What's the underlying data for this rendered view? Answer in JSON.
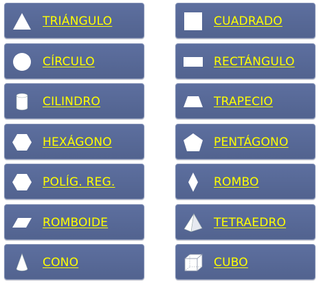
{
  "colors": {
    "tile_bg": "#58699a",
    "label": "#ffff00",
    "icon": "#ffffff"
  },
  "left_column": [
    {
      "label": "TRIÁNGULO",
      "icon": "triangle-icon"
    },
    {
      "label": "CÍRCULO",
      "icon": "circle-icon"
    },
    {
      "label": "CILINDRO",
      "icon": "cylinder-icon"
    },
    {
      "label": "HEXÁGONO",
      "icon": "hexagon-icon"
    },
    {
      "label": "POLÍG. REG.",
      "icon": "regular-polygon-icon"
    },
    {
      "label": "ROMBOIDE",
      "icon": "rhomboid-icon"
    },
    {
      "label": "CONO",
      "icon": "cone-icon"
    }
  ],
  "right_column": [
    {
      "label": "CUADRADO",
      "icon": "square-icon"
    },
    {
      "label": "RECTÁNGULO",
      "icon": "rectangle-icon"
    },
    {
      "label": "TRAPECIO",
      "icon": "trapezoid-icon"
    },
    {
      "label": "PENTÁGONO",
      "icon": "pentagon-icon"
    },
    {
      "label": "ROMBO",
      "icon": "rhombus-icon"
    },
    {
      "label": "TETRAEDRO",
      "icon": "tetrahedron-icon"
    },
    {
      "label": "CUBO",
      "icon": "cube-icon"
    }
  ]
}
